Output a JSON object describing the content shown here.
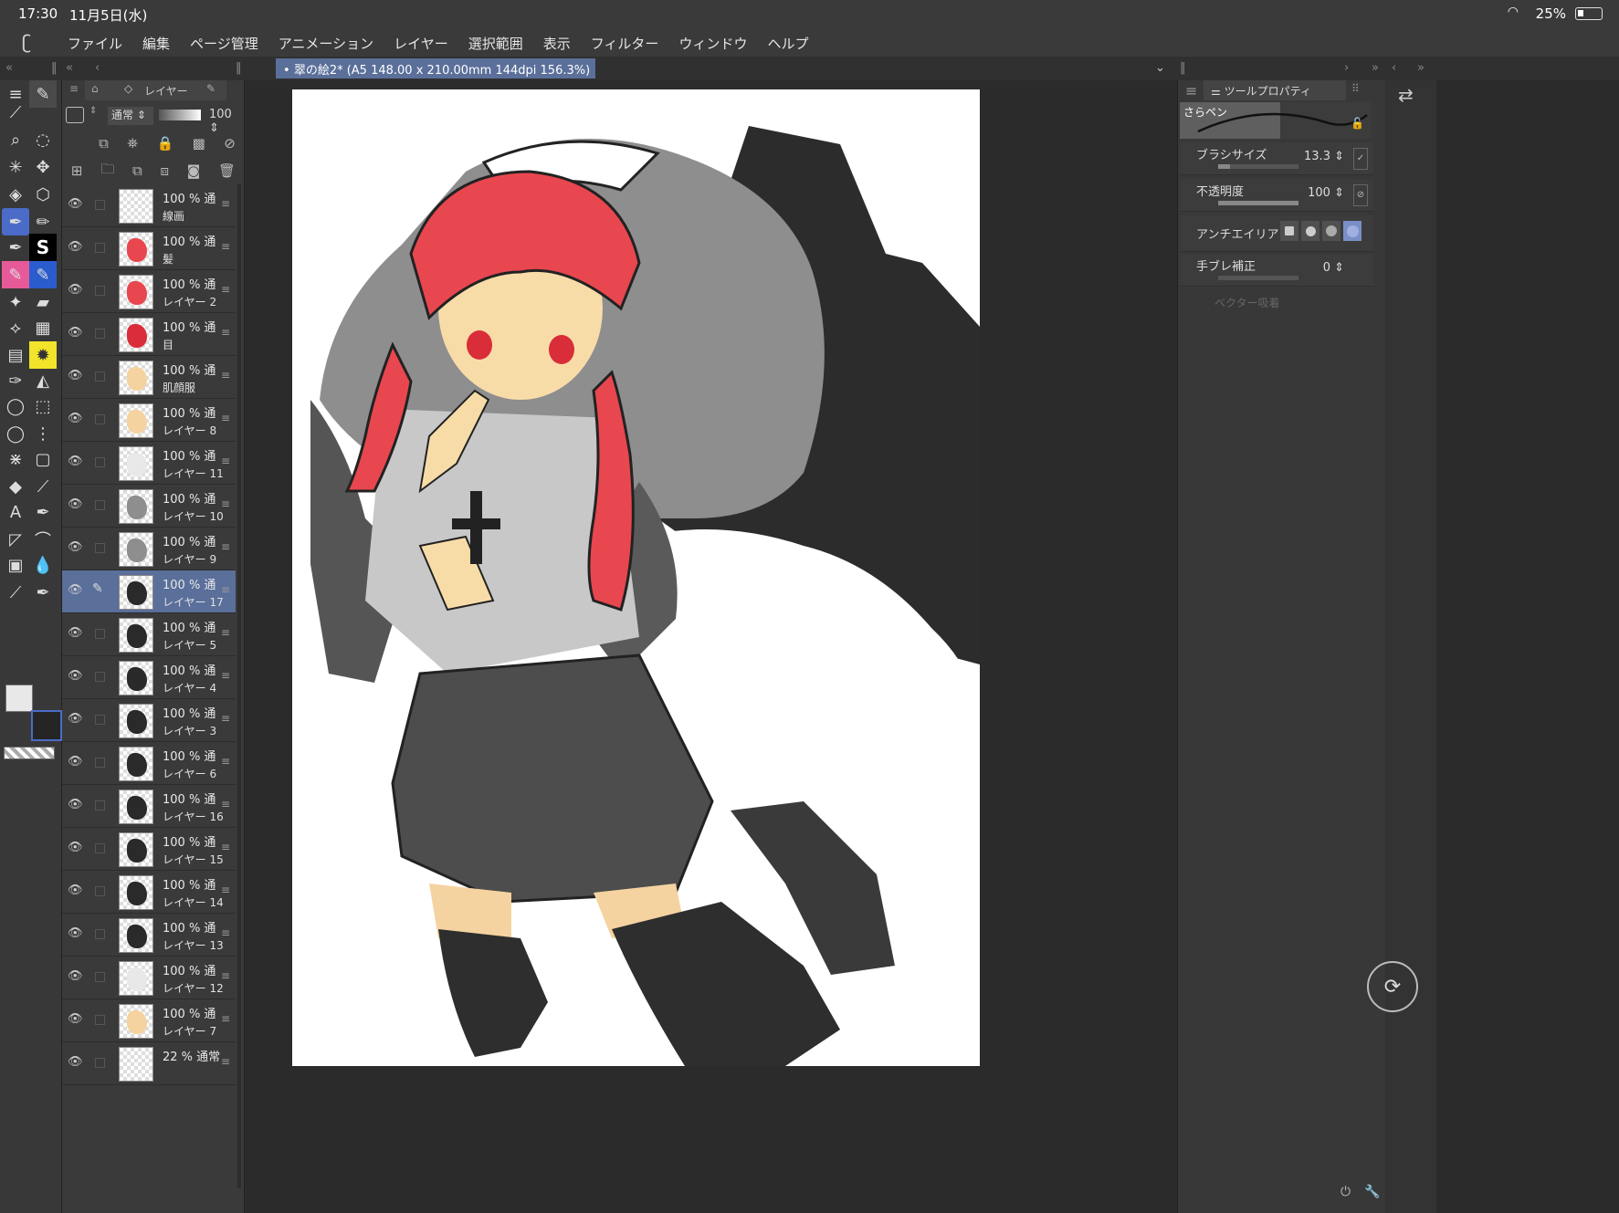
{
  "status": {
    "time": "17:30",
    "date": "11月5日(水)",
    "battery": "25%"
  },
  "menu": [
    "ファイル",
    "編集",
    "ページ管理",
    "アニメーション",
    "レイヤー",
    "選択範囲",
    "表示",
    "フィルター",
    "ウィンドウ",
    "ヘルプ"
  ],
  "document_tab": "翠の絵2* (A5 148.00 x 210.00mm 144dpi 156.3%)",
  "layer_panel": {
    "tab_label": "レイヤー",
    "blend_mode": "通常",
    "opacity": "100"
  },
  "layers": [
    {
      "meta": "100 % 通",
      "name": "線画",
      "thumb": "sketch"
    },
    {
      "meta": "100 % 通",
      "name": "髪",
      "thumb": "hair"
    },
    {
      "meta": "100 % 通",
      "name": "レイヤー 2",
      "thumb": "red"
    },
    {
      "meta": "100 % 通",
      "name": "目",
      "thumb": "eyes"
    },
    {
      "meta": "100 % 通",
      "name": "肌顔服",
      "thumb": "skin"
    },
    {
      "meta": "100 % 通",
      "name": "レイヤー 8",
      "thumb": "skin"
    },
    {
      "meta": "100 % 通",
      "name": "レイヤー 11",
      "thumb": "light"
    },
    {
      "meta": "100 % 通",
      "name": "レイヤー 10",
      "thumb": "grey"
    },
    {
      "meta": "100 % 通",
      "name": "レイヤー 9",
      "thumb": "grey"
    },
    {
      "meta": "100 % 通",
      "name": "レイヤー 17",
      "thumb": "dark",
      "selected": true
    },
    {
      "meta": "100 % 通",
      "name": "レイヤー 5",
      "thumb": "dark"
    },
    {
      "meta": "100 % 通",
      "name": "レイヤー 4",
      "thumb": "dark"
    },
    {
      "meta": "100 % 通",
      "name": "レイヤー 3",
      "thumb": "dark"
    },
    {
      "meta": "100 % 通",
      "name": "レイヤー 6",
      "thumb": "dark"
    },
    {
      "meta": "100 % 通",
      "name": "レイヤー 16",
      "thumb": "dark"
    },
    {
      "meta": "100 % 通",
      "name": "レイヤー 15",
      "thumb": "dark"
    },
    {
      "meta": "100 % 通",
      "name": "レイヤー 14",
      "thumb": "dark"
    },
    {
      "meta": "100 % 通",
      "name": "レイヤー 13",
      "thumb": "dark"
    },
    {
      "meta": "100 % 通",
      "name": "レイヤー 12",
      "thumb": "light"
    },
    {
      "meta": "100 % 通",
      "name": "レイヤー 7",
      "thumb": "skin"
    },
    {
      "meta": "22 % 通常",
      "name": "",
      "thumb": "sketch"
    }
  ],
  "tool_property": {
    "tab_label": "ツールプロパティ",
    "brush_name": "さらペン",
    "brush_size_label": "ブラシサイズ",
    "brush_size": "13.3",
    "brush_size_fraction": 0.15,
    "opacity_label": "不透明度",
    "opacity": "100",
    "opacity_fraction": 1.0,
    "antialias_label": "アンチエイリアス",
    "stabilization_label": "手ブレ補正",
    "stabilization": "0",
    "stabilization_fraction": 0.0,
    "vector_label": "ベクター吸着"
  },
  "colors": {
    "accent": "#5a6f9a",
    "main_color": "#e8e8e8",
    "sub_color": "#252525"
  }
}
